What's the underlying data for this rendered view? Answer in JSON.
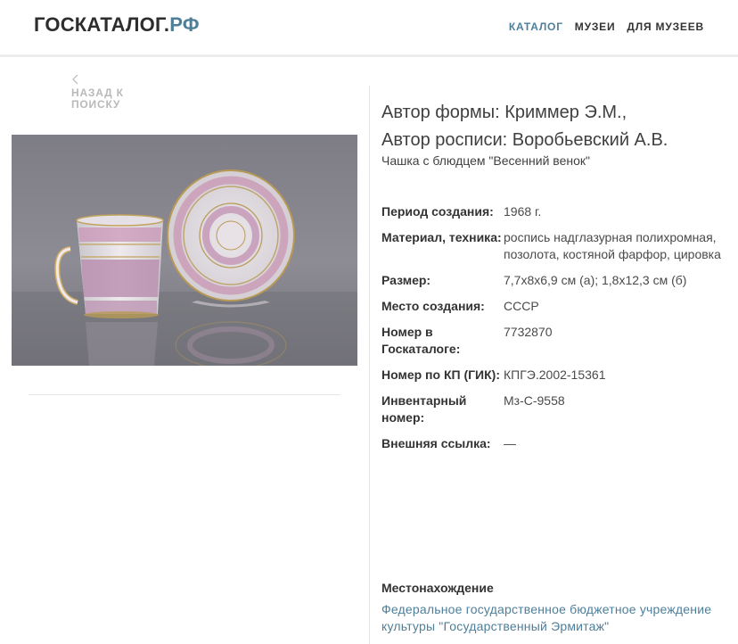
{
  "header": {
    "logo_main": "ГОСКАТАЛОГ.",
    "logo_tld": "РФ",
    "nav": [
      {
        "label": "КАТАЛОГ",
        "active": true
      },
      {
        "label": "МУЗЕИ",
        "active": false
      },
      {
        "label": "ДЛЯ МУЗЕЕВ",
        "active": false
      }
    ],
    "accent_color": "#4e7f99"
  },
  "back": {
    "icon": "chevron-left-icon",
    "line1": "НАЗАД К",
    "line2": "ПОИСКУ"
  },
  "object": {
    "title_line1": "Автор формы: Криммер Э.М.,",
    "title_line2": "Автор росписи: Воробьевский А.В.",
    "subtitle": "Чашка с блюдцем \"Весенний венок\"",
    "image": "photo-cup-and-saucer",
    "properties": [
      {
        "label": "Период создания:",
        "value": "1968 г."
      },
      {
        "label": "Материал, техника:",
        "value": "роспись надглазурная полихромная, позолота, костяной фарфор, цировка"
      },
      {
        "label": "Размер:",
        "value": "7,7x8x6,9 см (а); 1,8x12,3 см (б)"
      },
      {
        "label": "Место создания:",
        "value": "СССР"
      },
      {
        "label": "Номер в Госкаталоге:",
        "value": "7732870"
      },
      {
        "label": "Номер по КП (ГИК):",
        "value": "КПГЭ.2002-15361"
      },
      {
        "label": "Инвентарный номер:",
        "value": "Мз-С-9558"
      },
      {
        "label": "Внешняя ссылка:",
        "value": "—"
      }
    ]
  },
  "location": {
    "heading": "Местонахождение",
    "link_text": "Федеральное государственное бюджетное учреждение культуры \"Государственный Эрмитаж\""
  }
}
